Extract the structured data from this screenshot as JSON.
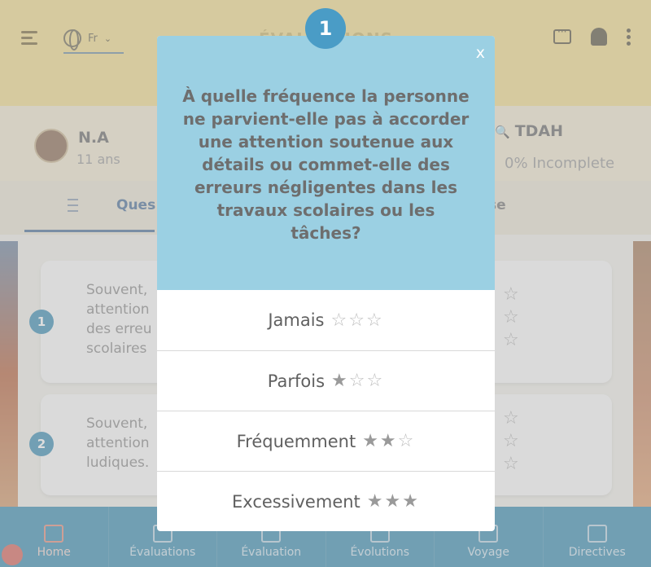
{
  "header": {
    "language": "Fr",
    "app_title": "ÉVALUATIONS"
  },
  "profile": {
    "name": "N.A",
    "age": "11 ans",
    "diagnosis": "TDAH",
    "status": "0% Incomplete"
  },
  "tabs": {
    "questions_label": "Ques",
    "right_label": "se"
  },
  "cards": [
    {
      "number": "1",
      "text": "Souvent,\nattention\ndes erreu\nscolaires"
    },
    {
      "number": "2",
      "text": "Souvent,\nattention\nludiques."
    }
  ],
  "bottom_nav": [
    {
      "label": "Home",
      "icon": "home-icon"
    },
    {
      "label": "Évaluations",
      "icon": "send-icon"
    },
    {
      "label": "Évaluation",
      "icon": "list-icon"
    },
    {
      "label": "Évolutions",
      "icon": "chevron-icon"
    },
    {
      "label": "Voyage",
      "icon": "chat-icon"
    },
    {
      "label": "Directives",
      "icon": "play-icon"
    }
  ],
  "modal": {
    "badge": "1",
    "close": "x",
    "question": "À quelle fréquence la personne ne parvient-elle pas à accorder une attention soutenue aux détails ou commet-elle des erreurs négligentes dans les travaux scolaires ou les tâches?",
    "options": [
      {
        "label": "Jamais",
        "rating": 0
      },
      {
        "label": "Parfois",
        "rating": 1
      },
      {
        "label": "Fréquemment",
        "rating": 2
      },
      {
        "label": "Excessivement",
        "rating": 3
      }
    ]
  },
  "colors": {
    "modal_header": "#9bd0e3",
    "badge": "#4a9cc6",
    "bottom_nav": "#3b8fb2"
  }
}
